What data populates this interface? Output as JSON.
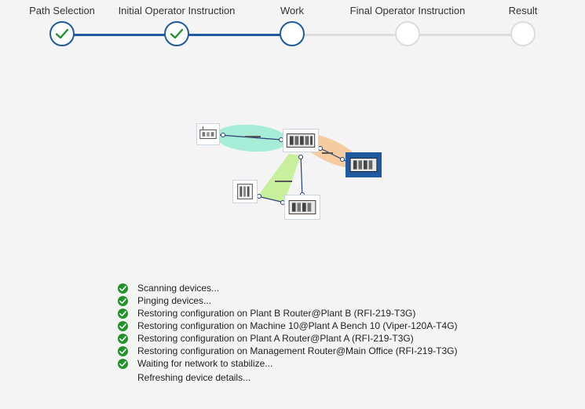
{
  "stepper": {
    "steps": [
      {
        "label": "Path Selection",
        "state": "done"
      },
      {
        "label": "Initial Operator Instruction",
        "state": "done"
      },
      {
        "label": "Work",
        "state": "current"
      },
      {
        "label": "Final Operator Instruction",
        "state": "pending"
      },
      {
        "label": "Result",
        "state": "pending"
      }
    ]
  },
  "colors": {
    "accent": "#1e5aa0",
    "success": "#21932b",
    "pending": "#dcdcdc",
    "link_teal": "#a6ecd6",
    "link_orange": "#f5ccA0",
    "link_green": "#c8ef9c"
  },
  "diagram": {
    "devices": [
      {
        "icon": "router-device-icon"
      },
      {
        "icon": "router-device-icon"
      },
      {
        "icon": "router-device-icon",
        "selected": true
      },
      {
        "icon": "router-device-icon"
      },
      {
        "icon": "machine-device-icon"
      }
    ]
  },
  "log": {
    "items": [
      {
        "text": "Scanning devices...",
        "status": "done"
      },
      {
        "text": "Pinging devices...",
        "status": "done"
      },
      {
        "text": "Restoring configuration on Plant B Router@Plant B (RFI-219-T3G)",
        "status": "done"
      },
      {
        "text": "Restoring configuration on Machine 10@Plant A Bench 10 (Viper-120A-T4G)",
        "status": "done"
      },
      {
        "text": "Restoring configuration on Plant A Router@Plant A (RFI-219-T3G)",
        "status": "done"
      },
      {
        "text": "Restoring configuration on Management Router@Main Office (RFI-219-T3G)",
        "status": "done"
      },
      {
        "text": "Waiting for network to stabilize...",
        "status": "done"
      },
      {
        "text": "Refreshing device details...",
        "status": "running"
      }
    ]
  }
}
